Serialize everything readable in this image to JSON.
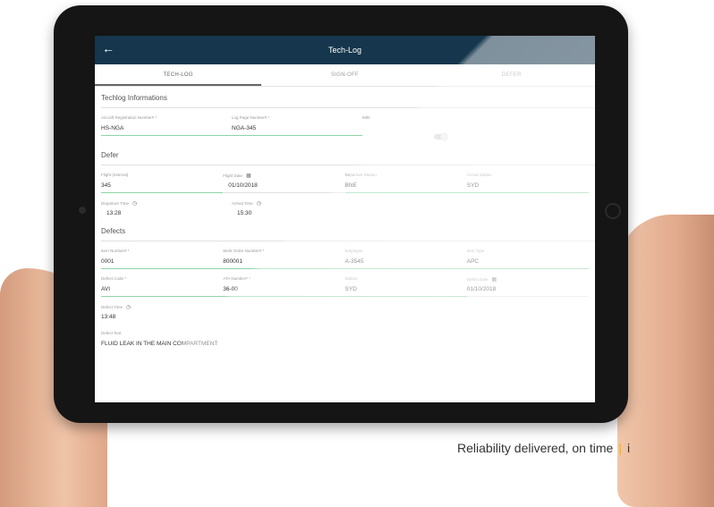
{
  "appbar": {
    "title": "Tech-Log"
  },
  "tabs": [
    {
      "label": "TECH-LOG",
      "active": true
    },
    {
      "label": "SIGN-OFF",
      "active": false
    },
    {
      "label": "DEFER",
      "active": false
    }
  ],
  "sections": {
    "techlog": {
      "title": "Techlog Informations",
      "fields": [
        {
          "label": "Aircraft Registration Number# *",
          "value": "HS-NGA"
        },
        {
          "label": "Log Page Number# *",
          "value": "NGA-345"
        },
        {
          "label": "IMD",
          "value": ""
        }
      ]
    },
    "defer": {
      "title": "Defer",
      "row1": [
        {
          "label": "Flight (Internal)",
          "value": "345"
        },
        {
          "label": "Flight Date",
          "value": "01/10/2018"
        },
        {
          "label": "Departure Station",
          "value": "BNE"
        },
        {
          "label": "Arrival Station",
          "value": "SYD"
        }
      ],
      "row2": [
        {
          "label": "Departure Time",
          "value": "13:28"
        },
        {
          "label": "Arrival Time",
          "value": "15:30"
        }
      ]
    },
    "defects": {
      "title": "Defects",
      "row1": [
        {
          "label": "Item Number# *",
          "value": "0001"
        },
        {
          "label": "Work Order Number# *",
          "value": "800001"
        },
        {
          "label": "Employee",
          "value": "A-3545"
        },
        {
          "label": "Item Type",
          "value": "APC"
        }
      ],
      "row2": [
        {
          "label": "Defect Code *",
          "value": "AVI"
        },
        {
          "label": "ATA Number# *",
          "value": "36-00"
        },
        {
          "label": "Station",
          "value": "SYD"
        },
        {
          "label": "Defect Date",
          "value": "01/10/2018"
        }
      ],
      "row3": [
        {
          "label": "Defect Time",
          "value": "13:48"
        }
      ],
      "defect_text": {
        "label": "Defect Text",
        "value": "FLUID LEAK IN THE MAIN COMPARTMENT"
      }
    }
  },
  "tagline": {
    "text": "Reliability delivered, on time",
    "separator": "|",
    "trailing": "i"
  },
  "colors": {
    "appbar": "#15364c",
    "underline_active": "#8dd5a8",
    "accent": "#f4b400"
  }
}
